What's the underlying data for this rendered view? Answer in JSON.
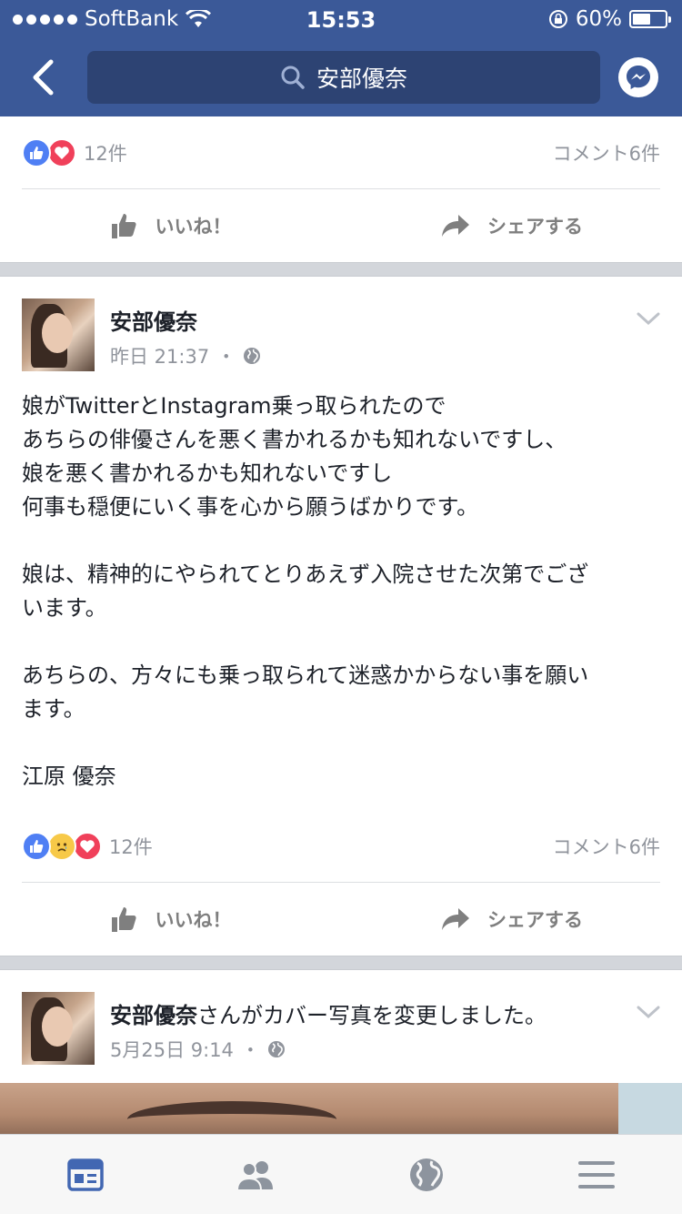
{
  "status_bar": {
    "carrier": "SoftBank",
    "time": "15:53",
    "battery_text": "60%",
    "battery_level": 0.6
  },
  "header": {
    "search_text": "安部優奈",
    "back_icon": "chevron-left-icon",
    "messenger_icon": "messenger-icon"
  },
  "post_top": {
    "reaction_count": "12件",
    "comment_count": "コメント6件",
    "like_label": "いいね！",
    "share_label": "シェアする"
  },
  "post_main": {
    "author": "安部優奈",
    "timestamp": "昨日 21:37",
    "dot": "・",
    "body": [
      "娘がTwitterとInstagram乗っ取られたので",
      "あちらの俳優さんを悪く書かれるかも知れないですし、",
      "娘を悪く書かれるかも知れないですし",
      "何事も穏便にいく事を心から願うばかりです。",
      "",
      "娘は、精神的にやられてとりあえず入院させた次第でござ",
      "います。",
      "",
      "あちらの、方々にも乗っ取られて迷惑かからない事を願い",
      "ます。",
      "",
      "江原  優奈"
    ],
    "reaction_count": "12件",
    "comment_count": "コメント6件",
    "like_label": "いいね！",
    "share_label": "シェアする"
  },
  "post_cover": {
    "author": "安部優奈",
    "action_text": "さんがカバー写真を変更しました。",
    "timestamp": "5月25日 9:14",
    "dot": "・"
  },
  "tabbar": {
    "tabs": [
      "news-feed-icon",
      "friends-icon",
      "globe-icon",
      "menu-icon"
    ],
    "active_color": "#4267b2",
    "inactive_color": "#8d949e"
  },
  "colors": {
    "brand": "#3b5998",
    "like_blue": "#4f7ff4",
    "love_red": "#f0405a",
    "sad_yellow": "#f7c948"
  }
}
